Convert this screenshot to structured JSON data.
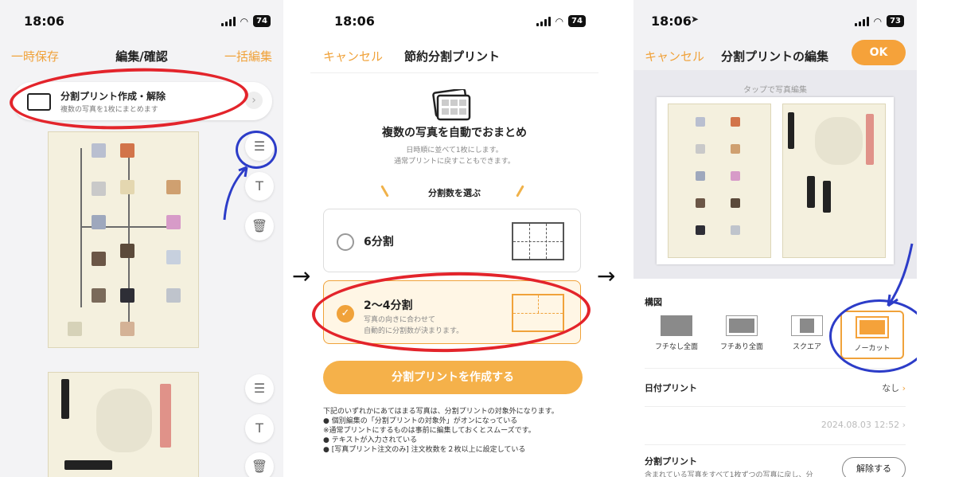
{
  "panel1": {
    "status": {
      "time": "18:06",
      "battery": "74"
    },
    "nav": {
      "left": "一時保存",
      "title": "編集/確認",
      "right": "一括編集"
    },
    "banner": {
      "title": "分割プリント作成・解除",
      "subtitle": "複数の写真を1枚にまとめます"
    },
    "side_icons": [
      "adjust-icon",
      "text-icon",
      "trash-icon"
    ],
    "text_icon_glyph": "T"
  },
  "panel2": {
    "status": {
      "time": "18:06",
      "battery": "74"
    },
    "nav": {
      "left": "キャンセル",
      "title": "節約分割プリント"
    },
    "heading": "複数の写真を自動でおまとめ",
    "desc_line1": "日時順に並べて1枚にします。",
    "desc_line2": "通常プリントに戻すこともできます。",
    "choose_label": "分割数を選ぶ",
    "option1": {
      "label": "6分割"
    },
    "option2": {
      "label": "2〜4分割",
      "desc_line1": "写真の向きに合わせて",
      "desc_line2": "自動的に分割数が決まります。"
    },
    "cta": "分割プリントを作成する",
    "notes": {
      "intro": "下記のいずれかにあてはまる写真は、分割プリントの対象外になります。",
      "item1": "● 個別編集の「分割プリントの対象外」がオンになっている",
      "item1_note": "※通常プリントにするものは事前に編集しておくとスムーズです。",
      "item2": "● テキストが入力されている",
      "item3": "● [写真プリント注文のみ] 注文枚数を２枚以上に設定している"
    }
  },
  "panel3": {
    "status": {
      "time": "18:06",
      "battery": "73"
    },
    "nav": {
      "left": "キャンセル",
      "title": "分割プリントの編集",
      "ok": "OK"
    },
    "tap_hint": "タップで写真編集",
    "composition_label": "構図",
    "layouts": [
      "フチなし全面",
      "フチあり全面",
      "スクエア",
      "ノーカット"
    ],
    "selected_layout": "ノーカット",
    "date_print": {
      "label": "日付プリント",
      "value": "なし"
    },
    "date_value": "2024.08.03 12:52",
    "split_print": {
      "label": "分割プリント",
      "desc": "含まれている写真をすべて1枚ずつの写真に戻し、分",
      "button": "解除する"
    }
  },
  "colors": {
    "accent": "#f0a23a",
    "annotation_red": "#e3242b",
    "annotation_blue": "#2c3cc8"
  }
}
